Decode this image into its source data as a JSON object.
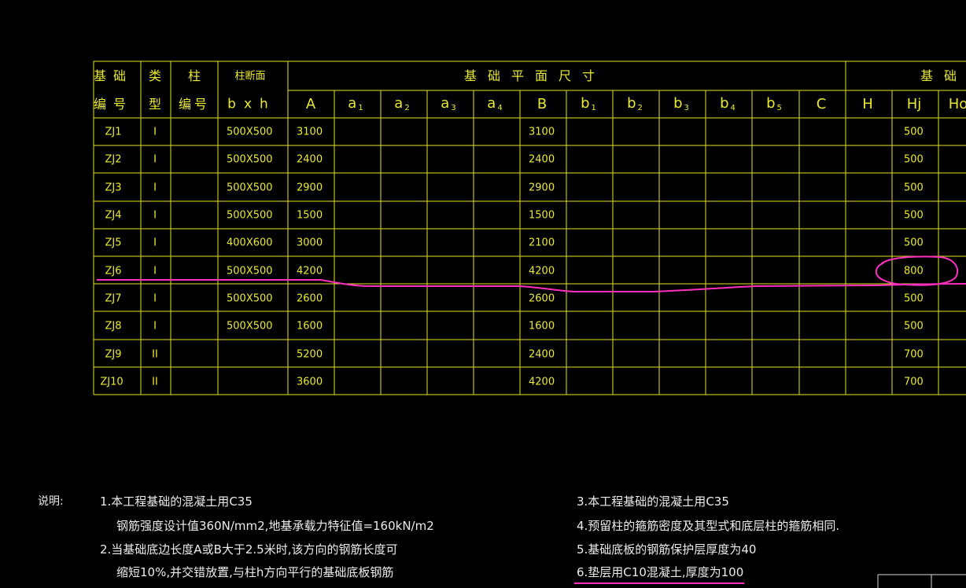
{
  "colors": {
    "background": "#000000",
    "grid": "#e3e321",
    "table_text": "#e9e930",
    "note_text": "#ececec",
    "annotation": "#ff2fbf"
  },
  "table": {
    "header_top": {
      "col_code": "基础",
      "col_type": "类",
      "col_column_id": "柱",
      "col_section": "柱断面",
      "plan_size": "基础平面尺寸",
      "foundation_partial": "基础"
    },
    "header_bottom": {
      "col_code": "编号",
      "col_type": "型",
      "col_column_id": "编号",
      "col_section": "bxh",
      "A": "A",
      "a1": "a",
      "a1_sub": "1",
      "a2": "a",
      "a2_sub": "2",
      "a3": "a",
      "a3_sub": "3",
      "a4": "a",
      "a4_sub": "4",
      "B": "B",
      "b1": "b",
      "b1_sub": "1",
      "b2": "b",
      "b2_sub": "2",
      "b3": "b",
      "b3_sub": "3",
      "b4": "b",
      "b4_sub": "4",
      "b5": "b",
      "b5_sub": "5",
      "C": "C",
      "H": "H",
      "Hj": "Hj",
      "Ho": "Ho"
    },
    "rows": [
      {
        "code": "ZJ1",
        "type": "I",
        "section": "500X500",
        "A": "3100",
        "B": "3100",
        "Hj": "500"
      },
      {
        "code": "ZJ2",
        "type": "I",
        "section": "500X500",
        "A": "2400",
        "B": "2400",
        "Hj": "500"
      },
      {
        "code": "ZJ3",
        "type": "I",
        "section": "500X500",
        "A": "2900",
        "B": "2900",
        "Hj": "500"
      },
      {
        "code": "ZJ4",
        "type": "I",
        "section": "500X500",
        "A": "1500",
        "B": "1500",
        "Hj": "500"
      },
      {
        "code": "ZJ5",
        "type": "I",
        "section": "400X600",
        "A": "3000",
        "B": "2100",
        "Hj": "500"
      },
      {
        "code": "ZJ6",
        "type": "I",
        "section": "500X500",
        "A": "4200",
        "B": "4200",
        "Hj": "800"
      },
      {
        "code": "ZJ7",
        "type": "I",
        "section": "500X500",
        "A": "2600",
        "B": "2600",
        "Hj": "500"
      },
      {
        "code": "ZJ8",
        "type": "I",
        "section": "500X500",
        "A": "1600",
        "B": "1600",
        "Hj": "500"
      },
      {
        "code": "ZJ9",
        "type": "II",
        "section": "",
        "A": "5200",
        "B": "2400",
        "Hj": "700"
      },
      {
        "code": "ZJ10",
        "type": "II",
        "section": "",
        "A": "3600",
        "B": "4200",
        "Hj": "700"
      }
    ]
  },
  "notes": {
    "label": "说明:",
    "left": [
      "1.本工程基础的混凝土用C35",
      "钢筋强度设计值360N/mm2,地基承载力特征值=160kN/m2",
      "2.当基础底边长度A或B大于2.5米时,该方向的钢筋长度可",
      "缩短10%,并交错放置,与柱h方向平行的基础底板钢筋"
    ],
    "right": [
      "3.本工程基础的混凝土用C35",
      "4.预留柱的箍筋密度及其型式和底层柱的箍筋相同.",
      "5.基础底板的钢筋保护层厚度为40",
      "6.垫层用C10混凝土,厚度为100"
    ]
  }
}
